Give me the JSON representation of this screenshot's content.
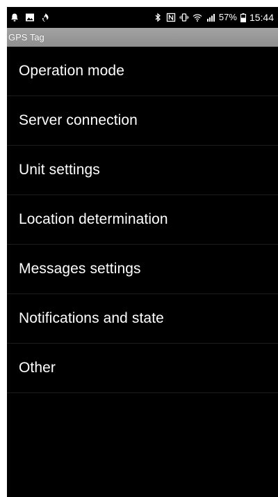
{
  "status_bar": {
    "left_icons": [
      "notification-bell-icon",
      "image-icon",
      "flame-icon"
    ],
    "right_icons": [
      "bluetooth-icon",
      "nfc-icon",
      "vibrate-icon",
      "wifi-icon",
      "signal-icon"
    ],
    "battery_percent": "57%",
    "time": "15:44"
  },
  "app_bar": {
    "title": "GPS Tag"
  },
  "menu": {
    "items": [
      {
        "label": "Operation mode"
      },
      {
        "label": "Server connection"
      },
      {
        "label": "Unit settings"
      },
      {
        "label": "Location determination"
      },
      {
        "label": "Messages settings"
      },
      {
        "label": "Notifications and state"
      },
      {
        "label": "Other"
      }
    ]
  },
  "colors": {
    "background": "#000000",
    "title_bar": "#9b9b9b",
    "text": "#ffffff",
    "divider": "#1c1c1c"
  }
}
